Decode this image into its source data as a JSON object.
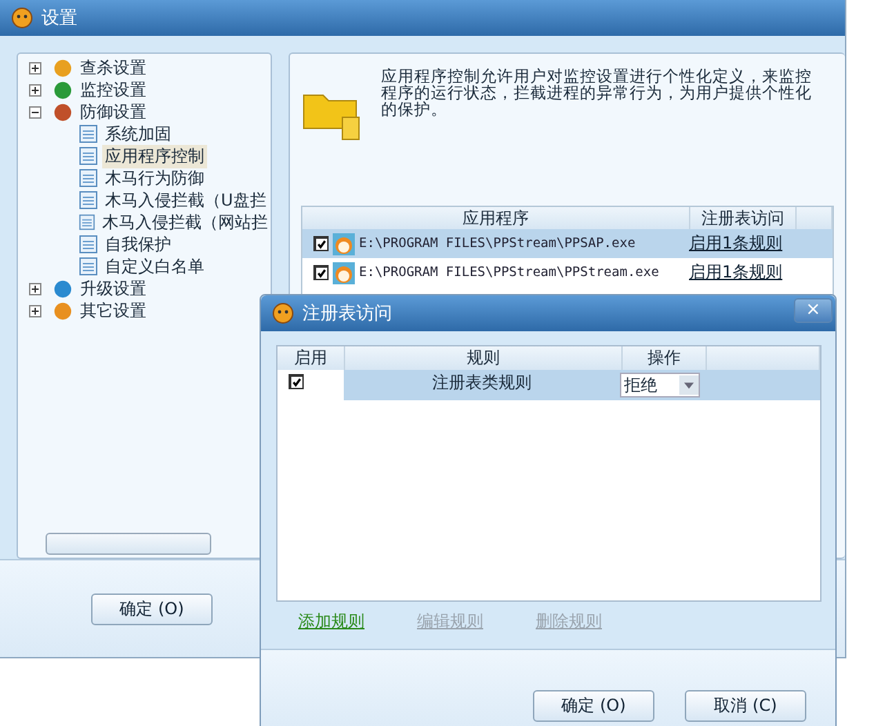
{
  "window": {
    "title": "设置"
  },
  "tree": [
    {
      "label": "查杀设置",
      "expanded": false,
      "selected": false
    },
    {
      "label": "监控设置",
      "expanded": false,
      "selected": false
    },
    {
      "label": "防御设置",
      "expanded": true,
      "selected": false,
      "children": [
        {
          "label": "系统加固",
          "selected": false
        },
        {
          "label": "应用程序控制",
          "selected": true
        },
        {
          "label": "木马行为防御",
          "selected": false
        },
        {
          "label": "木马入侵拦截（U盘拦",
          "selected": false
        },
        {
          "label": "木马入侵拦截（网站拦",
          "selected": false
        },
        {
          "label": "自我保护",
          "selected": false
        },
        {
          "label": "自定义白名单",
          "selected": false
        }
      ]
    },
    {
      "label": "升级设置",
      "expanded": false,
      "selected": false
    },
    {
      "label": "其它设置",
      "expanded": false,
      "selected": false
    }
  ],
  "description": "应用程序控制允许用户对监控设置进行个性化定义，来监控程序的运行状态，拦截进程的异常行为，为用户提供个性化的保护。",
  "app_table": {
    "columns": [
      "应用程序",
      "注册表访问"
    ],
    "rows": [
      {
        "checked": true,
        "selected": true,
        "path": "E:\\PROGRAM FILES\\PPStream\\PPSAP.exe",
        "rule_link": "启用1条规则"
      },
      {
        "checked": true,
        "selected": false,
        "path": "E:\\PROGRAM FILES\\PPStream\\PPStream.exe",
        "rule_link": "启用1条规则"
      }
    ]
  },
  "ok_button": "确定 (O)",
  "dialog": {
    "title": "注册表访问",
    "close": "×",
    "columns": [
      "启用",
      "规则",
      "操作"
    ],
    "rows": [
      {
        "checked": true,
        "selected": true,
        "rule": "注册表类规则",
        "action": "拒绝"
      }
    ],
    "links": [
      {
        "label": "添加规则",
        "disabled": false
      },
      {
        "label": "编辑规则",
        "disabled": true
      },
      {
        "label": "删除规则",
        "disabled": true
      }
    ],
    "buttons": [
      "确定 (O)",
      "取消 (C)"
    ]
  }
}
